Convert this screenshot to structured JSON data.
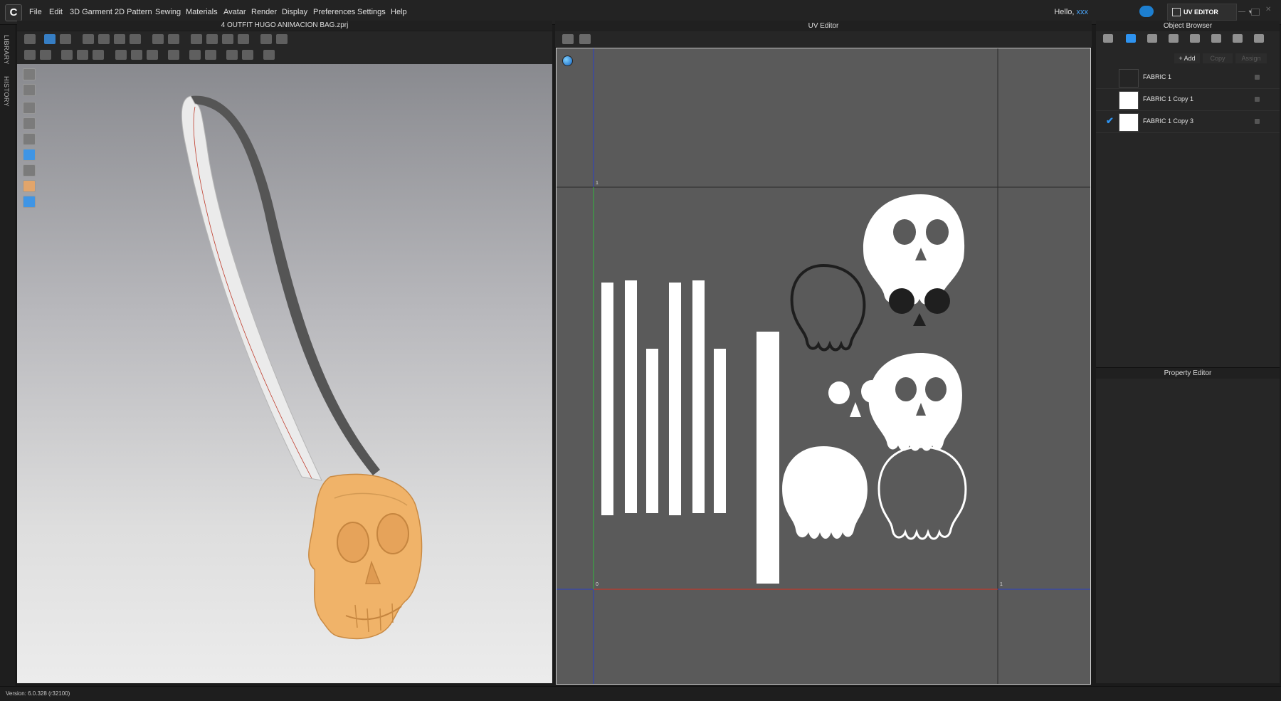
{
  "app": {
    "menu": [
      "File",
      "Edit",
      "3D Garment",
      "2D Pattern",
      "Sewing",
      "Materials",
      "Avatar",
      "Render",
      "Display",
      "Preferences",
      "Settings",
      "Help"
    ],
    "greeting": "Hello,",
    "username": "xxx",
    "mode_label": "UV EDITOR",
    "mode_dropdown": "▾"
  },
  "side_tabs": {
    "library": "LIBRARY",
    "history": "HISTORY"
  },
  "viewport3d": {
    "title": "4 OUTFIT HUGO ANIMACION BAG.zprj"
  },
  "uv_editor": {
    "title": "UV Editor",
    "axis_labels": {
      "top_left_1": "1",
      "origin_0": "0",
      "right_1": "1"
    },
    "colors": {
      "u_axis": "#c0392b",
      "v_axis": "#3aa844",
      "frame": "#2a40c8"
    }
  },
  "object_browser": {
    "title": "Object Browser",
    "buttons": {
      "add": "+ Add",
      "copy": "Copy",
      "assign": "Assign"
    },
    "fabrics": [
      {
        "name": "FABRIC 1",
        "swatch": "#252525",
        "checked": false
      },
      {
        "name": "FABRIC 1 Copy 1",
        "swatch": "#ffffff",
        "checked": false
      },
      {
        "name": "FABRIC 1 Copy 3",
        "swatch": "#ffffff",
        "checked": true
      }
    ],
    "check_glyph": "✔"
  },
  "property_editor": {
    "title": "Property Editor"
  },
  "status": {
    "version": "Version: 6.0.328 (r32100)"
  }
}
